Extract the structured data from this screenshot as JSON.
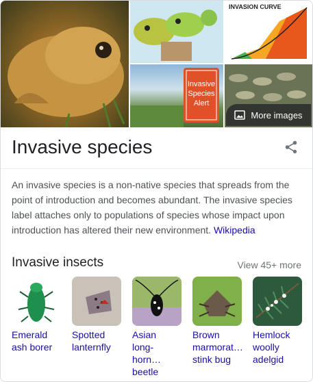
{
  "gallery": {
    "more_images_label": "More images",
    "curve_chart_title": "INVASION CURVE",
    "sign_text": "Invasive\nSpecies\nAlert"
  },
  "header": {
    "title": "Invasive species"
  },
  "description": {
    "text": "An invasive species is a non-native species that spreads from the point of introduction and becomes abundant. The invasive species label attaches only to populations of species whose impact upon introduction has altered their new environment.",
    "link": "Wikipedia"
  },
  "insects_section": {
    "title": "Invasive insects",
    "view_more": "View 45+ more",
    "items": [
      {
        "label": "Emerald\nash borer"
      },
      {
        "label": "Spotted\nlanternfly"
      },
      {
        "label": "Asian\nlong-horn…\nbeetle"
      },
      {
        "label": "Brown\nmarmorat…\nstink bug"
      },
      {
        "label": "Hemlock\nwoolly\nadelgid"
      }
    ]
  },
  "colors": {
    "link": "#1a0dab",
    "text": "#202124",
    "body_text": "#4d5156",
    "muted": "#70757a"
  }
}
